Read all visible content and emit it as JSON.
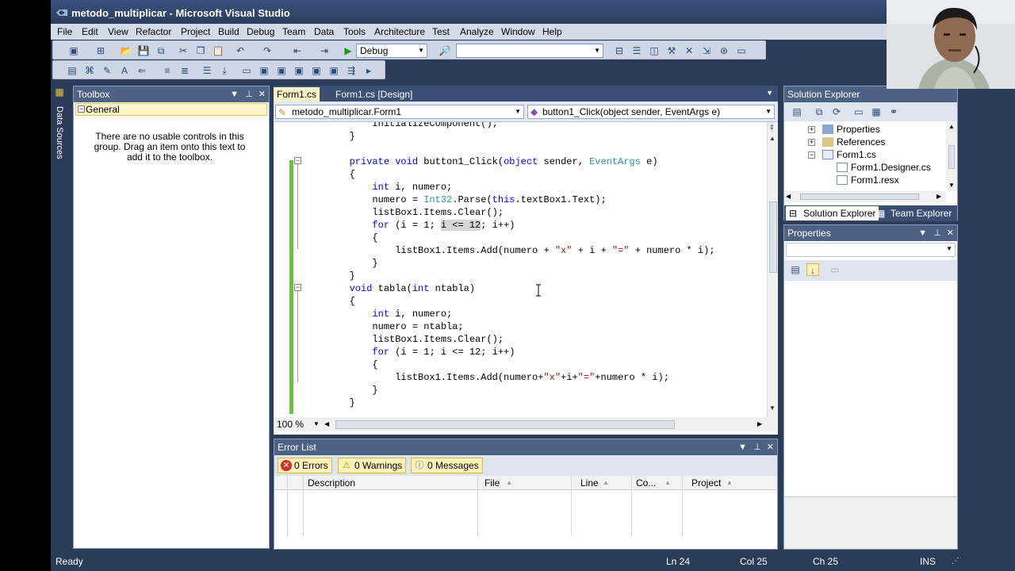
{
  "window": {
    "title": "metodo_multiplicar - Microsoft Visual Studio"
  },
  "menu": [
    "File",
    "Edit",
    "View",
    "Refactor",
    "Project",
    "Build",
    "Debug",
    "Team",
    "Data",
    "Tools",
    "Architecture",
    "Test",
    "Analyze",
    "Window",
    "Help"
  ],
  "toolbar": {
    "config": "Debug",
    "platform": ""
  },
  "leftstrip": {
    "label": "Data Sources"
  },
  "toolbox": {
    "title": "Toolbox",
    "group": "General",
    "message": "There are no usable controls in this group. Drag an item onto this text to add it to the toolbox."
  },
  "editor": {
    "tabs": [
      "Form1.cs",
      "Form1.cs [Design]"
    ],
    "active_tab": "Form1.cs",
    "class_combo": "metodo_multiplicar.Form1",
    "member_combo": "button1_Click(object sender, EventArgs e)",
    "zoom": "100 %",
    "lines": [
      [
        {
          "t": "            InitializeComponent();"
        }
      ],
      [
        {
          "t": "        }"
        }
      ],
      [
        {
          "t": ""
        }
      ],
      [
        {
          "t": "        "
        },
        {
          "t": "private",
          "c": "kw"
        },
        {
          "t": " "
        },
        {
          "t": "void",
          "c": "kw"
        },
        {
          "t": " button1_Click("
        },
        {
          "t": "object",
          "c": "kw"
        },
        {
          "t": " sender, "
        },
        {
          "t": "EventArgs",
          "c": "ty"
        },
        {
          "t": " e)"
        }
      ],
      [
        {
          "t": "        {"
        }
      ],
      [
        {
          "t": "            "
        },
        {
          "t": "int",
          "c": "kw"
        },
        {
          "t": " i, numero;"
        }
      ],
      [
        {
          "t": "            numero = "
        },
        {
          "t": "Int32",
          "c": "ty"
        },
        {
          "t": ".Parse("
        },
        {
          "t": "this",
          "c": "kw"
        },
        {
          "t": ".textBox1.Text);"
        }
      ],
      [
        {
          "t": "            listBox1.Items.Clear();"
        }
      ],
      [
        {
          "t": "            "
        },
        {
          "t": "for",
          "c": "kw"
        },
        {
          "t": " (i = 1; "
        },
        {
          "t": "i <= 12",
          "c": "hl"
        },
        {
          "t": "; i++)"
        }
      ],
      [
        {
          "t": "            {"
        }
      ],
      [
        {
          "t": "                listBox1.Items.Add(numero + "
        },
        {
          "t": "\"x\"",
          "c": "st"
        },
        {
          "t": " + i + "
        },
        {
          "t": "\"=\"",
          "c": "st"
        },
        {
          "t": " + numero * i);"
        }
      ],
      [
        {
          "t": "            }"
        }
      ],
      [
        {
          "t": "        }"
        }
      ],
      [
        {
          "t": "        "
        },
        {
          "t": "void",
          "c": "kw"
        },
        {
          "t": " tabla("
        },
        {
          "t": "int",
          "c": "kw"
        },
        {
          "t": " ntabla)"
        }
      ],
      [
        {
          "t": "        {"
        }
      ],
      [
        {
          "t": "            "
        },
        {
          "t": "int",
          "c": "kw"
        },
        {
          "t": " i, numero;"
        }
      ],
      [
        {
          "t": "            numero = ntabla;"
        }
      ],
      [
        {
          "t": "            listBox1.Items.Clear();"
        }
      ],
      [
        {
          "t": "            "
        },
        {
          "t": "for",
          "c": "kw"
        },
        {
          "t": " (i = 1; i <= 12; i++)"
        }
      ],
      [
        {
          "t": "            {"
        }
      ],
      [
        {
          "t": "                listBox1.Items.Add(numero+"
        },
        {
          "t": "\"x\"",
          "c": "st"
        },
        {
          "t": "+i+"
        },
        {
          "t": "\"=\"",
          "c": "st"
        },
        {
          "t": "+numero * i);"
        }
      ],
      [
        {
          "t": "            }"
        }
      ],
      [
        {
          "t": "        }"
        }
      ]
    ]
  },
  "errorlist": {
    "title": "Error List",
    "errors": "0 Errors",
    "warnings": "0 Warnings",
    "messages": "0 Messages",
    "columns": [
      "Description",
      "File",
      "Line",
      "Co...",
      "Project"
    ]
  },
  "solution": {
    "title": "Solution Explorer",
    "items": [
      "Properties",
      "References",
      "Form1.cs",
      "Form1.Designer.cs",
      "Form1.resx"
    ],
    "tabs": [
      "Solution Explorer",
      "Team Explorer"
    ]
  },
  "properties": {
    "title": "Properties"
  },
  "status": {
    "state": "Ready",
    "ln": "Ln 24",
    "col": "Col 25",
    "ch": "Ch 25",
    "mode": "INS"
  }
}
